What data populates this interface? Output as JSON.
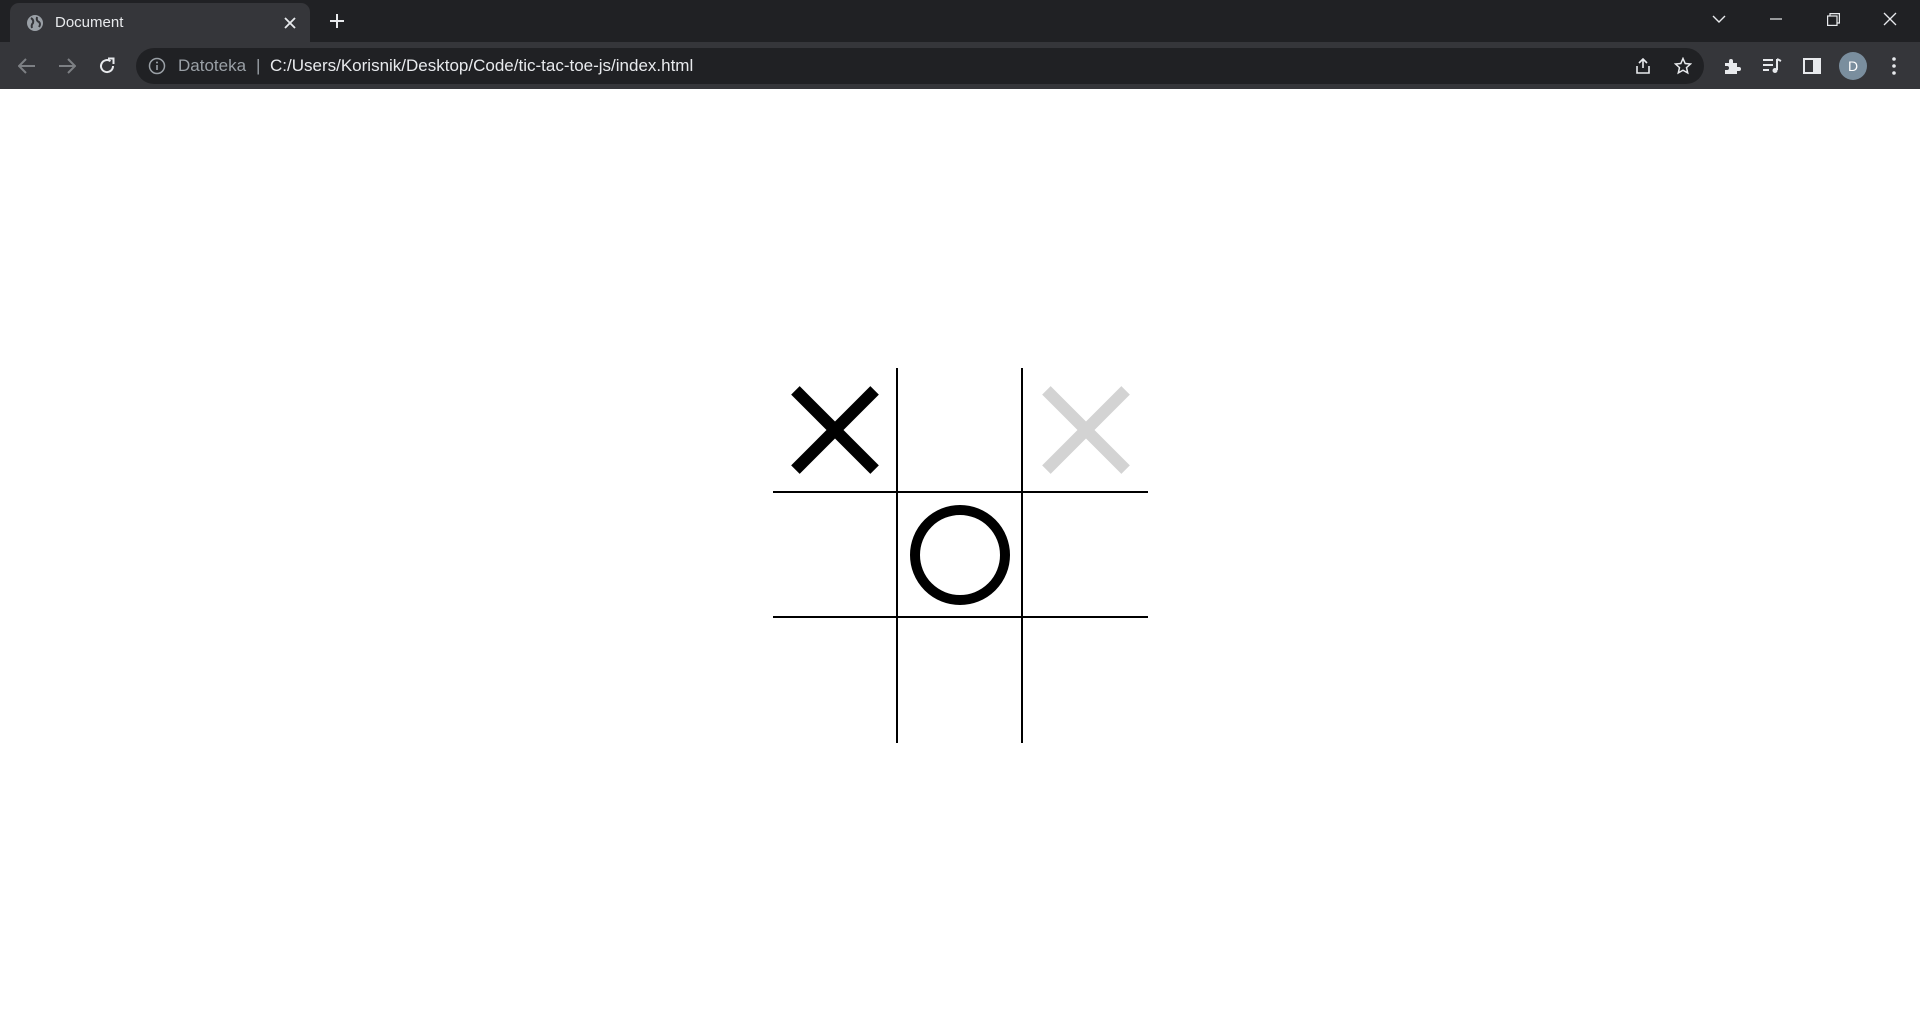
{
  "browser": {
    "tab": {
      "title": "Document",
      "favicon": "globe-icon"
    },
    "address_bar": {
      "scheme_label": "Datoteka",
      "separator": "|",
      "url": "C:/Users/Korisnik/Desktop/Code/tic-tac-toe-js/index.html"
    },
    "profile_initial": "D",
    "colors": {
      "frame": "#202124",
      "toolbar": "#35363a",
      "text": "#e8eaed",
      "muted": "#9aa0a6"
    }
  },
  "game": {
    "board": [
      [
        "X",
        "",
        "X-hover"
      ],
      [
        "",
        "O",
        ""
      ],
      [
        "",
        "",
        ""
      ]
    ],
    "mark_colors": {
      "X": "#000000",
      "O": "#000000",
      "X-hover": "#d3d3d3"
    }
  }
}
